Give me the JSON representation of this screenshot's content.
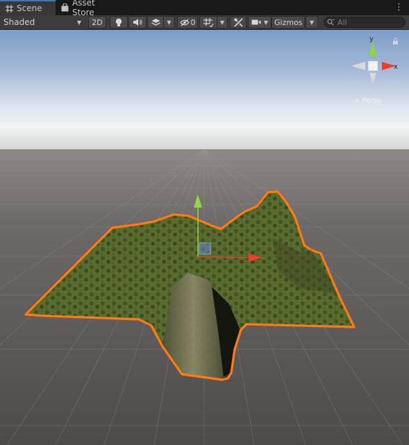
{
  "tabs": [
    {
      "label": "Scene",
      "icon": "grid-icon",
      "active": true
    },
    {
      "label": "Asset Store",
      "icon": "shopping-bag-icon",
      "active": false
    }
  ],
  "toolbar": {
    "shading_mode": "Shaded",
    "toggle_2d_label": "2D",
    "hidden_count": "0",
    "gizmos_label": "Gizmos",
    "search_placeholder": "All"
  },
  "orientation_gizmo": {
    "y_label": "y",
    "x_label": "x",
    "projection": "< Persp"
  },
  "colors": {
    "selection_outline": "#ff7a12",
    "axis_x": "#e8402b",
    "axis_y": "#8ed63d",
    "tab_accent": "#3a79bb"
  }
}
